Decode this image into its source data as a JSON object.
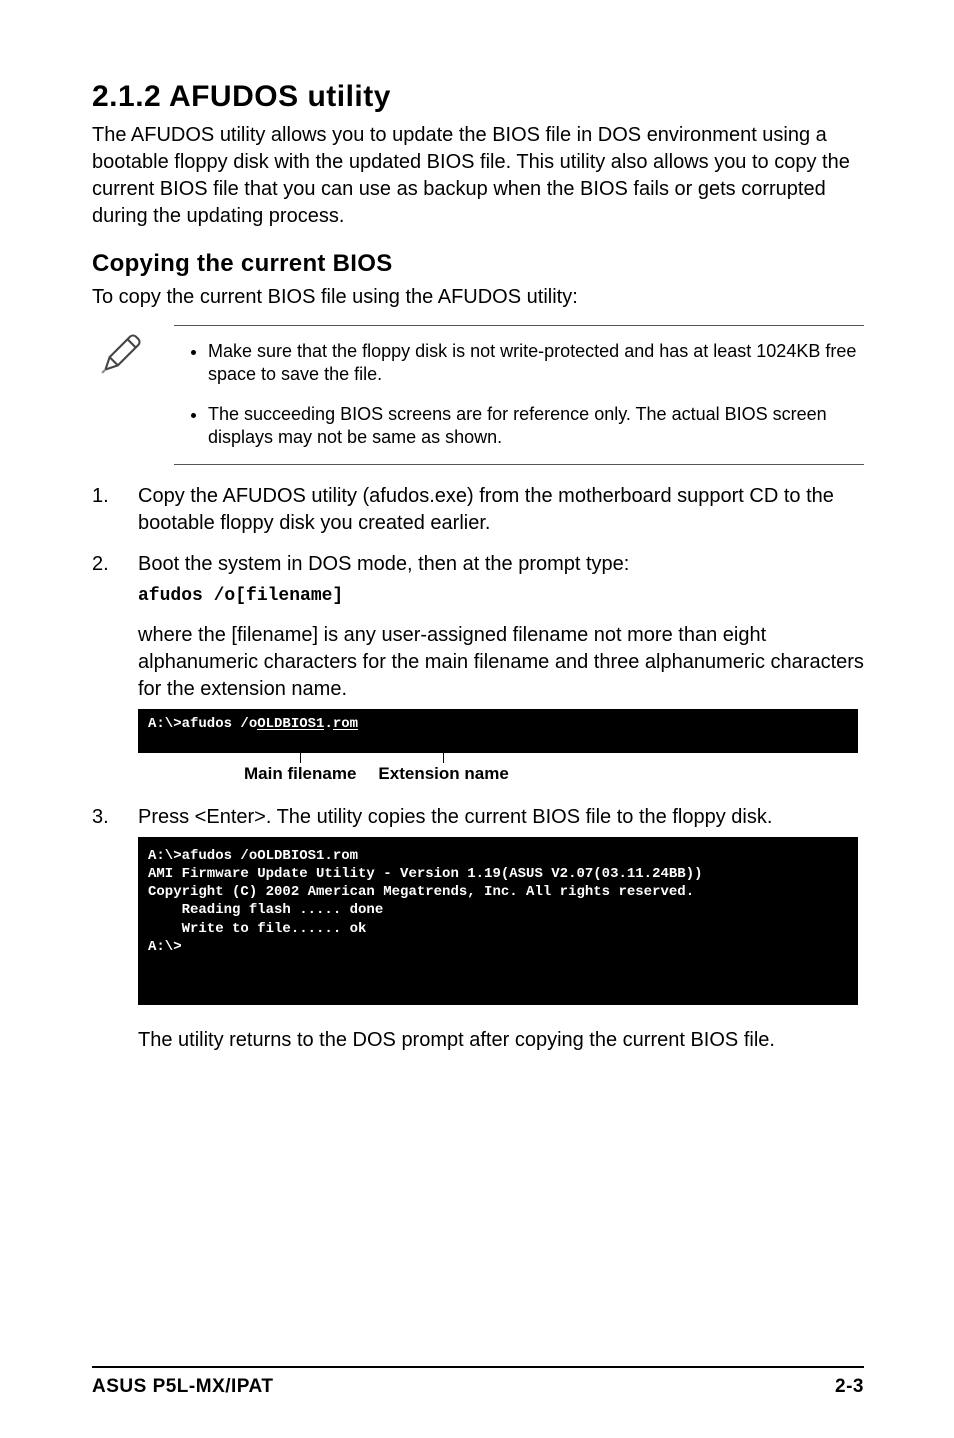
{
  "heading": {
    "section": "2.1.2   AFUDOS utility",
    "intro": "The AFUDOS utility allows you to update the BIOS file in DOS environment using a bootable floppy disk with the updated BIOS file. This utility also allows you to copy the current BIOS file that you can use as backup when the BIOS fails or gets corrupted during the updating process.",
    "subhead": "Copying the current BIOS",
    "sublead": "To copy the current BIOS file using the AFUDOS utility:"
  },
  "notes": {
    "item1": "Make sure that the floppy disk is not write-protected and has at least 1024KB free space to save the file.",
    "item2": "The succeeding BIOS screens are for reference only. The actual BIOS screen displays may not be same as shown."
  },
  "steps": {
    "n1": "1.",
    "s1": "Copy the AFUDOS utility (afudos.exe) from the motherboard support CD to the bootable floppy disk you created earlier.",
    "n2": "2.",
    "s2a": "Boot the system in DOS mode, then at the prompt type:",
    "s2cmd": "afudos /o[filename]",
    "s2b": "where the [filename] is any user-assigned filename not more than eight alphanumeric characters  for the main filename and three alphanumeric characters for the extension name.",
    "n3": "3.",
    "s3a": "Press <Enter>. The utility copies the current BIOS file to the floppy disk.",
    "s3b": "The utility returns to the DOS prompt after copying the current BIOS file."
  },
  "terminal1": {
    "prefix": "A:\\>afudos /o",
    "main": "OLDBIOS1",
    "dot": ".",
    "ext": "rom"
  },
  "anno": {
    "main": "Main filename",
    "ext": "Extension name"
  },
  "terminal2": "A:\\>afudos /oOLDBIOS1.rom\nAMI Firmware Update Utility - Version 1.19(ASUS V2.07(03.11.24BB))\nCopyright (C) 2002 American Megatrends, Inc. All rights reserved.\n    Reading flash ..... done\n    Write to file...... ok\nA:\\>",
  "footer": {
    "left": "ASUS P5L-MX/IPAT",
    "right": "2-3"
  }
}
